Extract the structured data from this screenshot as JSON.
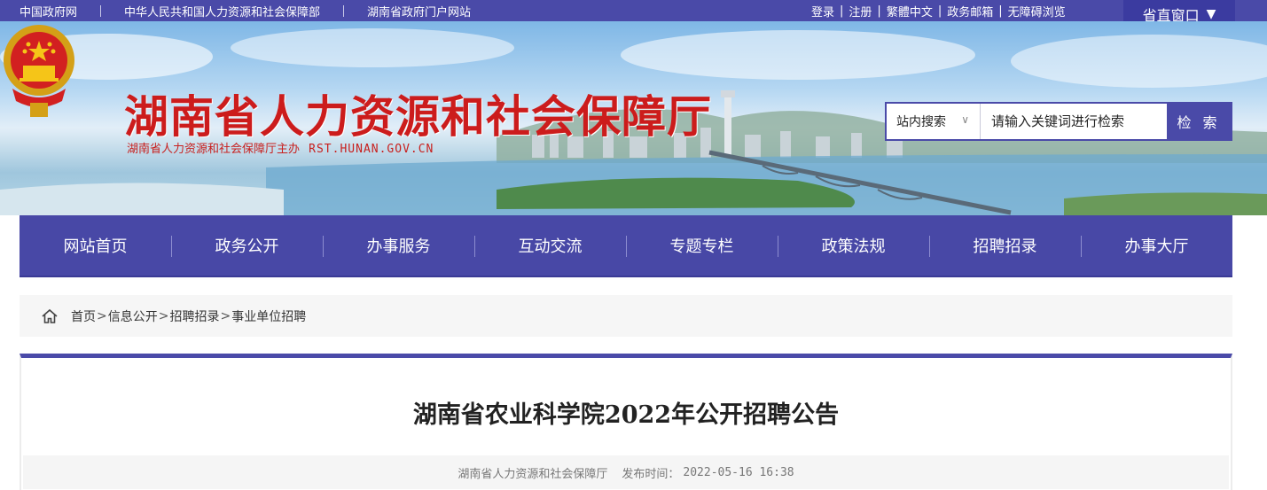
{
  "topbar": {
    "links": [
      "中国政府网",
      "中华人民共和国人力资源和社会保障部",
      "湖南省政府门户网站"
    ],
    "user_links": [
      "登录",
      "注册",
      "繁體中文",
      "政务邮箱",
      "无障碍浏览"
    ],
    "window_label": "省直窗口"
  },
  "header": {
    "title": "湖南省人力资源和社会保障厅",
    "subtitle": "湖南省人力资源和社会保障厅主办",
    "domain": "RST.HUNAN.GOV.CN"
  },
  "search": {
    "scope": "站内搜索",
    "placeholder": "请输入关键词进行检索",
    "button": "检 索"
  },
  "nav": {
    "items": [
      "网站首页",
      "政务公开",
      "办事服务",
      "互动交流",
      "专题专栏",
      "政策法规",
      "招聘招录",
      "办事大厅"
    ]
  },
  "breadcrumb": {
    "items": [
      "首页",
      "信息公开",
      "招聘招录",
      "事业单位招聘"
    ],
    "separator": ">"
  },
  "article": {
    "title": "湖南省农业科学院2022年公开招聘公告",
    "source": "湖南省人力资源和社会保障厅",
    "date_label": "发布时间：",
    "date": "2022-05-16 16:38"
  },
  "colors": {
    "primary": "#4a4aa8",
    "title_red": "#cc1c1c"
  }
}
